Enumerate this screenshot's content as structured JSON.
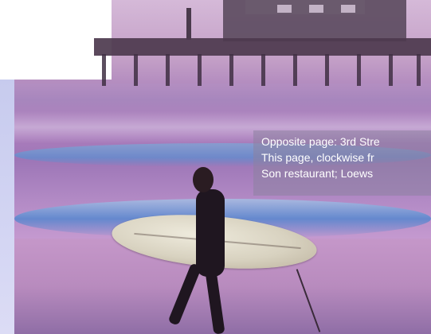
{
  "caption": {
    "line_1": "Opposite page: 3rd Stre",
    "line_2": "This page, clockwise fr",
    "line_3": "Son restaurant; Loews"
  },
  "colors": {
    "page_margin": "#c9cfe8",
    "caption_text": "#ffffff"
  },
  "photo": {
    "subject_icon": "surfer-photo"
  }
}
